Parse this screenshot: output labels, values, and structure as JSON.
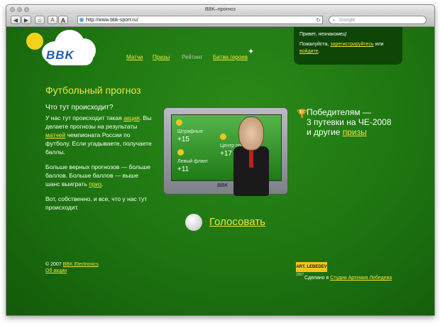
{
  "window": {
    "title": "BBK–прогноз"
  },
  "toolbar": {
    "back": "◀",
    "forward": "▶",
    "home": "⌂",
    "text_smaller": "A",
    "text_bigger": "A",
    "url": "http://www.bbk-sport.ru/",
    "reload": "↻",
    "search_placeholder": "Google"
  },
  "header": {
    "logo": "BBK",
    "nav": [
      {
        "label": "Матчи"
      },
      {
        "label": "Призы"
      },
      {
        "label": "Рейтинг"
      },
      {
        "label": "Битва героев"
      }
    ],
    "greeting": "Привет, незнакомец!",
    "login_prefix": "Пожалуйста,",
    "register_link": "зарегистрируйтесь",
    "login_or": "или",
    "login_link": "войдите",
    "login_suffix": "."
  },
  "main": {
    "title": "Футбольный прогноз",
    "what_heading": "Что тут происходит?",
    "p1": {
      "a": "У нас тут происходит такая",
      "link1": "акция",
      "b": ". Вы делаете прогнозы на результаты",
      "link2": "матчей",
      "c": "чемпионата России по футболу. Если угадываете, получаете баллы."
    },
    "p2": {
      "a": "Больше верных прогнозов — больше баллов. Больше баллов — выше шанс выиграть",
      "link": "приз",
      "b": "."
    },
    "p3": "Вот, собственно, и все, что у нас тут происходит.",
    "tv": {
      "brand": "BBK",
      "labels": [
        {
          "name": "Штрафные",
          "value": "+15"
        },
        {
          "name": "Центр поля",
          "value": "+17"
        },
        {
          "name": "Левый фланг",
          "value": "+11"
        }
      ]
    },
    "winners": {
      "line1": "Победителям —",
      "line2": "3 путевки на ЧЕ-2008",
      "line3a": "и другие",
      "line3_link": "призы"
    },
    "vote": "Голосовать"
  },
  "footer": {
    "copyright_prefix": "© 2007",
    "company_link": "BBK Electronics",
    "rules_link": "Об акции",
    "studio_logo": "ART. LEBEDEV",
    "studio_year": "2007",
    "made_prefix": "Сделано в",
    "studio_link": "Студии Артемия Лебедева"
  }
}
